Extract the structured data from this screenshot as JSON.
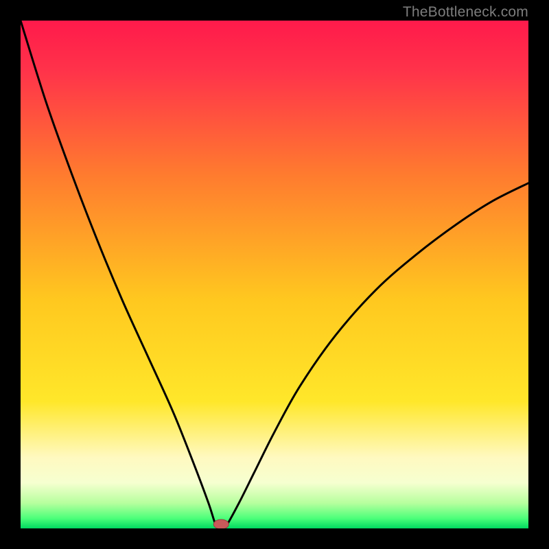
{
  "watermark": "TheBottleneck.com",
  "colors": {
    "frame": "#000000",
    "curve": "#000000",
    "marker_fill": "#c85a5a",
    "gradient_top": "#ff1a4b",
    "gradient_mid": "#ffd400",
    "gradient_cream": "#fff7b0",
    "gradient_green": "#00e060"
  },
  "chart_data": {
    "type": "line",
    "title": "",
    "xlabel": "",
    "ylabel": "",
    "xlim": [
      0,
      100
    ],
    "ylim": [
      0,
      100
    ],
    "series": [
      {
        "name": "bottleneck-curve",
        "x_norm": [
          0.0,
          0.05,
          0.1,
          0.15,
          0.2,
          0.25,
          0.3,
          0.34,
          0.37,
          0.385,
          0.395,
          0.405,
          0.43,
          0.46,
          0.5,
          0.55,
          0.62,
          0.7,
          0.78,
          0.86,
          0.93,
          1.0
        ],
        "y_norm": [
          1.0,
          0.84,
          0.7,
          0.57,
          0.45,
          0.34,
          0.23,
          0.13,
          0.05,
          0.005,
          0.0,
          0.005,
          0.05,
          0.11,
          0.19,
          0.28,
          0.38,
          0.47,
          0.54,
          0.6,
          0.645,
          0.68
        ]
      }
    ],
    "minimum_marker": {
      "x_norm": 0.395,
      "y_norm": 0.0
    },
    "notes": "x_norm,y_norm are fractions of the plot area; y_norm=0 is bottom (green), y_norm=1 is top (red). Values estimated from the image."
  }
}
